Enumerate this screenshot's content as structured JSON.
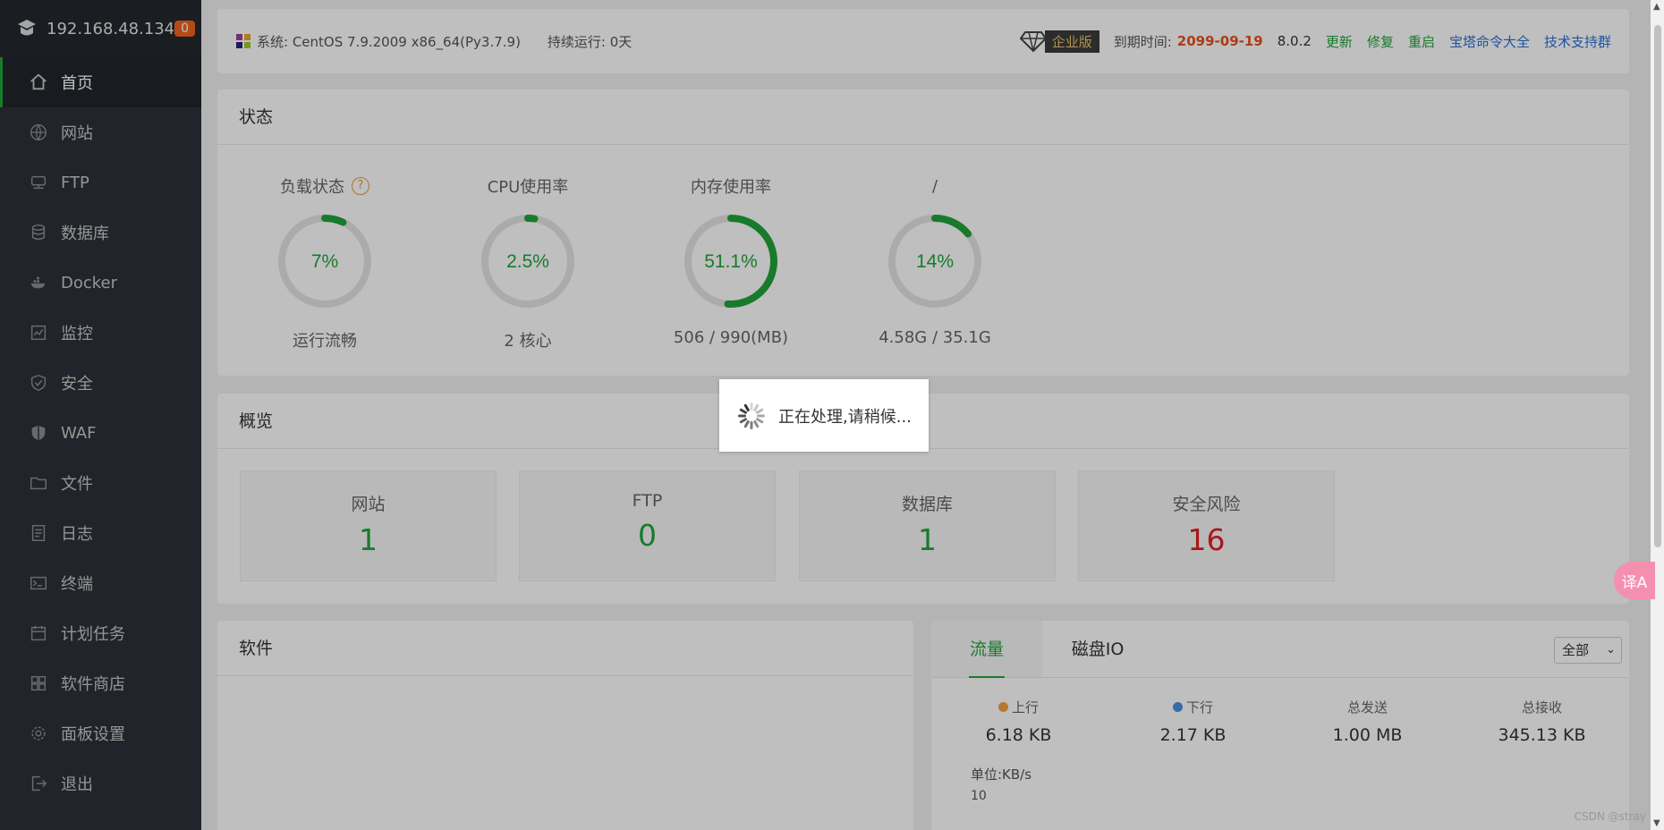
{
  "sidebar": {
    "ip": "192.168.48.134",
    "badge": "0",
    "items": [
      {
        "label": "首页",
        "icon": "home-icon"
      },
      {
        "label": "网站",
        "icon": "globe-icon"
      },
      {
        "label": "FTP",
        "icon": "ftp-icon"
      },
      {
        "label": "数据库",
        "icon": "database-icon"
      },
      {
        "label": "Docker",
        "icon": "docker-icon"
      },
      {
        "label": "监控",
        "icon": "monitor-icon"
      },
      {
        "label": "安全",
        "icon": "shield-icon"
      },
      {
        "label": "WAF",
        "icon": "waf-shield-icon"
      },
      {
        "label": "文件",
        "icon": "folder-icon"
      },
      {
        "label": "日志",
        "icon": "log-icon"
      },
      {
        "label": "终端",
        "icon": "terminal-icon"
      },
      {
        "label": "计划任务",
        "icon": "calendar-icon"
      },
      {
        "label": "软件商店",
        "icon": "grid-icon"
      },
      {
        "label": "面板设置",
        "icon": "gear-icon"
      },
      {
        "label": "退出",
        "icon": "logout-icon"
      }
    ]
  },
  "topbar": {
    "system": "系统:  CentOS 7.9.2009 x86_64(Py3.7.9)",
    "uptime": "持续运行: 0天",
    "edition": "企业版",
    "expire_label": "到期时间:",
    "expire_date": "2099-09-19",
    "version": "8.0.2",
    "update": "更新",
    "repair": "修复",
    "restart": "重启",
    "commands": "宝塔命令大全",
    "support": "技术支持群"
  },
  "status": {
    "title": "状态",
    "gauges": [
      {
        "title": "负载状态",
        "value": "7%",
        "percent": 7,
        "sub": "运行流畅",
        "help": "?"
      },
      {
        "title": "CPU使用率",
        "value": "2.5%",
        "percent": 2.5,
        "sub": "2 核心"
      },
      {
        "title": "内存使用率",
        "value": "51.1%",
        "percent": 51.1,
        "sub": "506 / 990(MB)"
      },
      {
        "title": "/",
        "value": "14%",
        "percent": 14,
        "sub": "4.58G / 35.1G"
      }
    ]
  },
  "overview": {
    "title": "概览",
    "cards": [
      {
        "label": "网站",
        "value": "1"
      },
      {
        "label": "FTP",
        "value": "0"
      },
      {
        "label": "数据库",
        "value": "1"
      },
      {
        "label": "安全风险",
        "value": "16"
      }
    ]
  },
  "software": {
    "title": "软件"
  },
  "traffic": {
    "tabs": [
      "流量",
      "磁盘IO"
    ],
    "select": "全部",
    "stats": [
      {
        "label": "上行",
        "value": "6.18 KB",
        "dot": "#f0a040"
      },
      {
        "label": "下行",
        "value": "2.17 KB",
        "dot": "#4a90e2"
      },
      {
        "label": "总发送",
        "value": "1.00 MB"
      },
      {
        "label": "总接收",
        "value": "345.13 KB"
      }
    ],
    "unit": "单位:KB/s",
    "first_tick": "10"
  },
  "loading": {
    "text": "正在处理,请稍候..."
  },
  "watermark": "CSDN @stray"
}
